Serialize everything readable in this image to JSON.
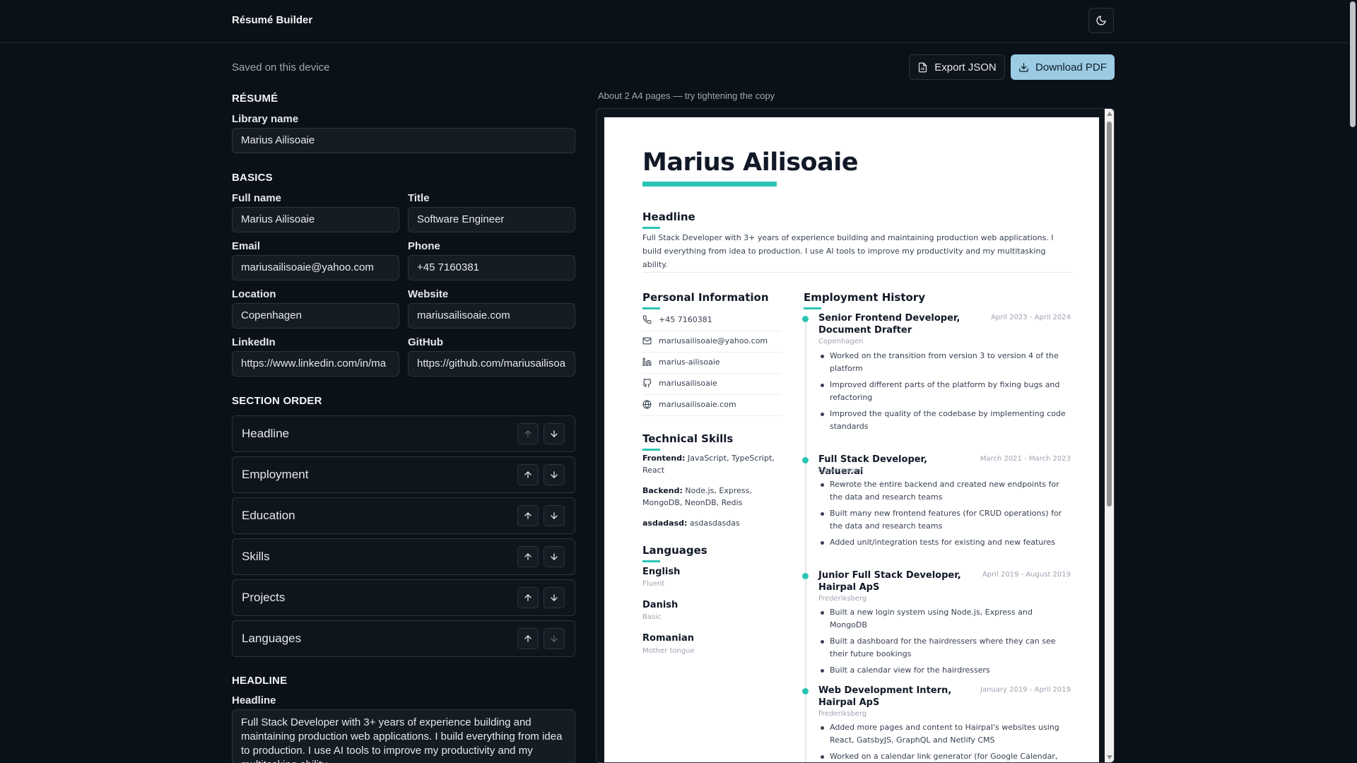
{
  "app": {
    "title": "Résumé Builder"
  },
  "status": {
    "saved": "Saved on this device"
  },
  "actions": {
    "export_label": "Export JSON",
    "download_label": "Download PDF"
  },
  "form": {
    "resume_section": "RÉSUMÉ",
    "library_label": "Library name",
    "library_value": "Marius Ailisoaie",
    "basics_section": "BASICS",
    "fields": {
      "full_name": {
        "label": "Full name",
        "value": "Marius Ailisoaie"
      },
      "title": {
        "label": "Title",
        "value": "Software Engineer"
      },
      "email": {
        "label": "Email",
        "value": "mariusailisoaie@yahoo.com"
      },
      "phone": {
        "label": "Phone",
        "value": "+45 7160381"
      },
      "location": {
        "label": "Location",
        "value": "Copenhagen"
      },
      "website": {
        "label": "Website",
        "value": "mariusailisoaie.com"
      },
      "linkedin": {
        "label": "LinkedIn",
        "value": "https://www.linkedin.com/in/ma"
      },
      "github": {
        "label": "GitHub",
        "value": "https://github.com/mariusailisoa"
      }
    },
    "order_section": "SECTION ORDER",
    "order": [
      "Headline",
      "Employment",
      "Education",
      "Skills",
      "Projects",
      "Languages"
    ],
    "headline_section": "HEADLINE",
    "headline_label": "Headline",
    "headline_value": "Full Stack Developer with 3+ years of experience building and maintaining production web applications. I build everything from idea to production. I use AI tools to improve my productivity and my multitasking ability."
  },
  "preview": {
    "pages_note": "About 2 A4 pages — try tightening the copy",
    "name": "Marius Ailisoaie",
    "headline_title": "Headline",
    "headline_text": "Full Stack Developer with 3+ years of experience building and maintaining production web applications. I build everything from idea to production. I use AI tools to improve my productivity and my multitasking ability.",
    "personal_title": "Personal Information",
    "personal": [
      {
        "icon": "phone-icon",
        "text": "+45 7160381"
      },
      {
        "icon": "mail-icon",
        "text": "mariusailisoaie@yahoo.com"
      },
      {
        "icon": "linkedin-icon",
        "text": "marius-ailisoaie"
      },
      {
        "icon": "github-icon",
        "text": "mariusailisoaie"
      },
      {
        "icon": "globe-icon",
        "text": "mariusailisoaie.com"
      }
    ],
    "skills_title": "Technical Skills",
    "skills": [
      {
        "name": "Frontend:",
        "items": "JavaScript, TypeScript, React"
      },
      {
        "name": "Backend:",
        "items": "Node.js, Express, MongoDB, NeonDB, Redis"
      },
      {
        "name": "asdadasd:",
        "items": "asdasdasdas"
      }
    ],
    "languages_title": "Languages",
    "languages": [
      {
        "name": "English",
        "level": "Fluent"
      },
      {
        "name": "Danish",
        "level": "Basic"
      },
      {
        "name": "Romanian",
        "level": "Mother tongue"
      }
    ],
    "employment_title": "Employment History",
    "jobs": [
      {
        "title": "Senior Frontend Developer, Document Drafter",
        "date": "April 2023 - April 2024",
        "location": "Copenhagen",
        "bullets": [
          "Worked on the transition from version 3 to version 4 of the platform",
          "Improved different parts of the platform by fixing bugs and refactoring",
          "Improved the quality of the codebase by implementing code standards"
        ]
      },
      {
        "title": "Full Stack Developer, Valuer.ai",
        "date": "March 2021 - March 2023",
        "location": "Copenhagen",
        "bullets": [
          "Rewrote the entire backend and created new endpoints for the data and research teams",
          "Built many new frontend features (for CRUD operations) for the data and research teams",
          "Added unit/integration tests for existing and new features"
        ]
      },
      {
        "title": "Junior Full Stack Developer, Hairpal ApS",
        "date": "April 2019 - August 2019",
        "location": "Frederiksberg",
        "bullets": [
          "Built a new login system using Node.js, Express and MongoDB",
          "Built a dashboard for the hairdressers where they can see their future bookings",
          "Built a calendar view for the hairdressers"
        ]
      },
      {
        "title": "Web Development Intern, Hairpal ApS",
        "date": "January 2019 - April 2019",
        "location": "Frederiksberg",
        "bullets": [
          "Added more pages and content to Hairpal's websites using React, GatsbyJS, GraphQL and Netlify CMS",
          "Worked on a calendar link generator (for Google Calendar, iCal"
        ]
      }
    ]
  },
  "colors": {
    "accent": "#2bc4b4",
    "primary_button": "#9ccbe4",
    "background": "#0b1118"
  }
}
